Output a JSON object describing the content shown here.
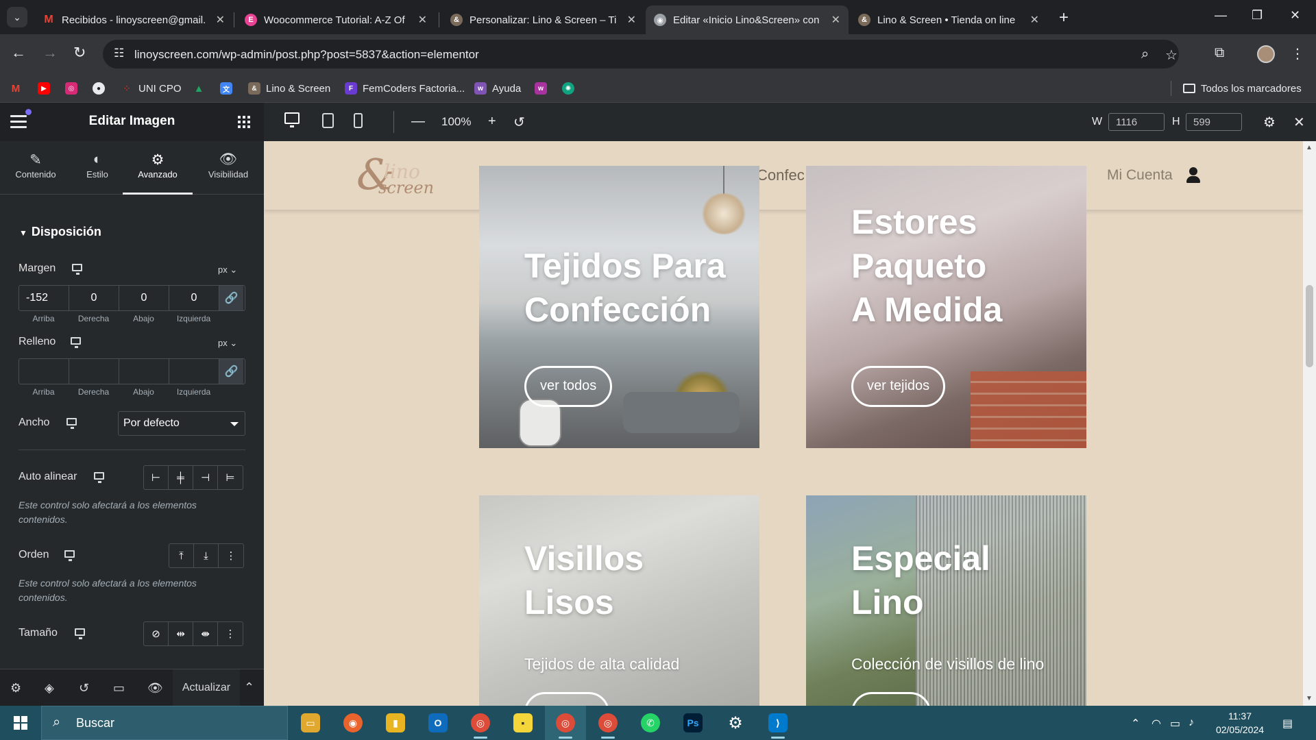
{
  "browser": {
    "tabs": [
      {
        "title": "Recibidos - linoyscreen@gmail.",
        "icon": "gmail-icon",
        "color": "#ea4335"
      },
      {
        "title": "Woocommerce Tutorial: A-Z Of",
        "icon": "elementor-icon",
        "color": "#e84393"
      },
      {
        "title": "Personalizar: Lino & Screen – Ti",
        "icon": "site-icon",
        "color": "#b08c72"
      },
      {
        "title": "Editar «Inicio Lino&Screen» con",
        "icon": "globe-icon",
        "color": "#9aa0a6",
        "active": true
      },
      {
        "title": "Lino & Screen • Tienda on line",
        "icon": "site-icon",
        "color": "#b08c72"
      }
    ],
    "url": "linoyscreen.com/wp-admin/post.php?post=5837&action=elementor",
    "bookmarks": [
      {
        "label": "",
        "icon": "gmail-icon",
        "color": "#ea4335"
      },
      {
        "label": "",
        "icon": "youtube-icon",
        "color": "#ff0000"
      },
      {
        "label": "",
        "icon": "instagram-icon",
        "color": "#d62976"
      },
      {
        "label": "",
        "icon": "github-icon",
        "color": "#f0f0f0"
      },
      {
        "label": "UNI CPO",
        "icon": "dots-icon",
        "color": "#d93025"
      },
      {
        "label": "",
        "icon": "drive-icon",
        "color": "#1fa463"
      },
      {
        "label": "",
        "icon": "translate-icon",
        "color": "#4285f4"
      },
      {
        "label": "Lino & Screen",
        "icon": "site-icon",
        "color": "#b08c72"
      },
      {
        "label": "FemCoders Factoria...",
        "icon": "femcoders-icon",
        "color": "#6a3bd0"
      },
      {
        "label": "Ayuda",
        "icon": "woo-icon",
        "color": "#7f54b3"
      },
      {
        "label": "",
        "icon": "woo-icon",
        "color": "#a8329e"
      },
      {
        "label": "",
        "icon": "chatgpt-icon",
        "color": "#10a37f"
      }
    ],
    "all_bookmarks": "Todos los marcadores"
  },
  "panel": {
    "title": "Editar Imagen",
    "tabs": [
      "Contenido",
      "Estilo",
      "Avanzado",
      "Visibilidad"
    ],
    "section": "Disposición",
    "margen": {
      "label": "Margen",
      "unit": "px",
      "values": [
        "-152",
        "0",
        "0",
        "0"
      ]
    },
    "relleno": {
      "label": "Relleno",
      "unit": "px",
      "values": [
        "",
        "",
        "",
        ""
      ]
    },
    "dim_labels": [
      "Arriba",
      "Derecha",
      "Abajo",
      "Izquierda"
    ],
    "ancho": {
      "label": "Ancho",
      "value": "Por defecto"
    },
    "auto_alinear": {
      "label": "Auto alinear"
    },
    "orden": {
      "label": "Orden"
    },
    "tamano": {
      "label": "Tamaño"
    },
    "note": "Este control solo afectará a los elementos contenidos.",
    "footer": {
      "update": "Actualizar"
    }
  },
  "topbar": {
    "zoom": "100%",
    "w_label": "W",
    "w_value": "1116",
    "h_label": "H",
    "h_value": "599"
  },
  "site": {
    "nav_partial": "Confec",
    "account": "Mi Cuenta",
    "logo": {
      "top": "lino",
      "bottom": "screen"
    },
    "cards": [
      {
        "title_lines": [
          "Tejidos Para",
          "Confección"
        ],
        "button": "ver todos"
      },
      {
        "title_lines": [
          "Estores",
          "Paqueto",
          "A Medida"
        ],
        "button": "ver tejidos"
      },
      {
        "title_lines": [
          "Visillos",
          "Lisos"
        ],
        "subtitle": "Tejidos de alta calidad"
      },
      {
        "title_lines": [
          "Especial",
          "Lino"
        ],
        "subtitle": "Colección de visillos de lino"
      }
    ]
  },
  "taskbar": {
    "search": "Buscar",
    "time": "11:37",
    "date": "02/05/2024"
  }
}
